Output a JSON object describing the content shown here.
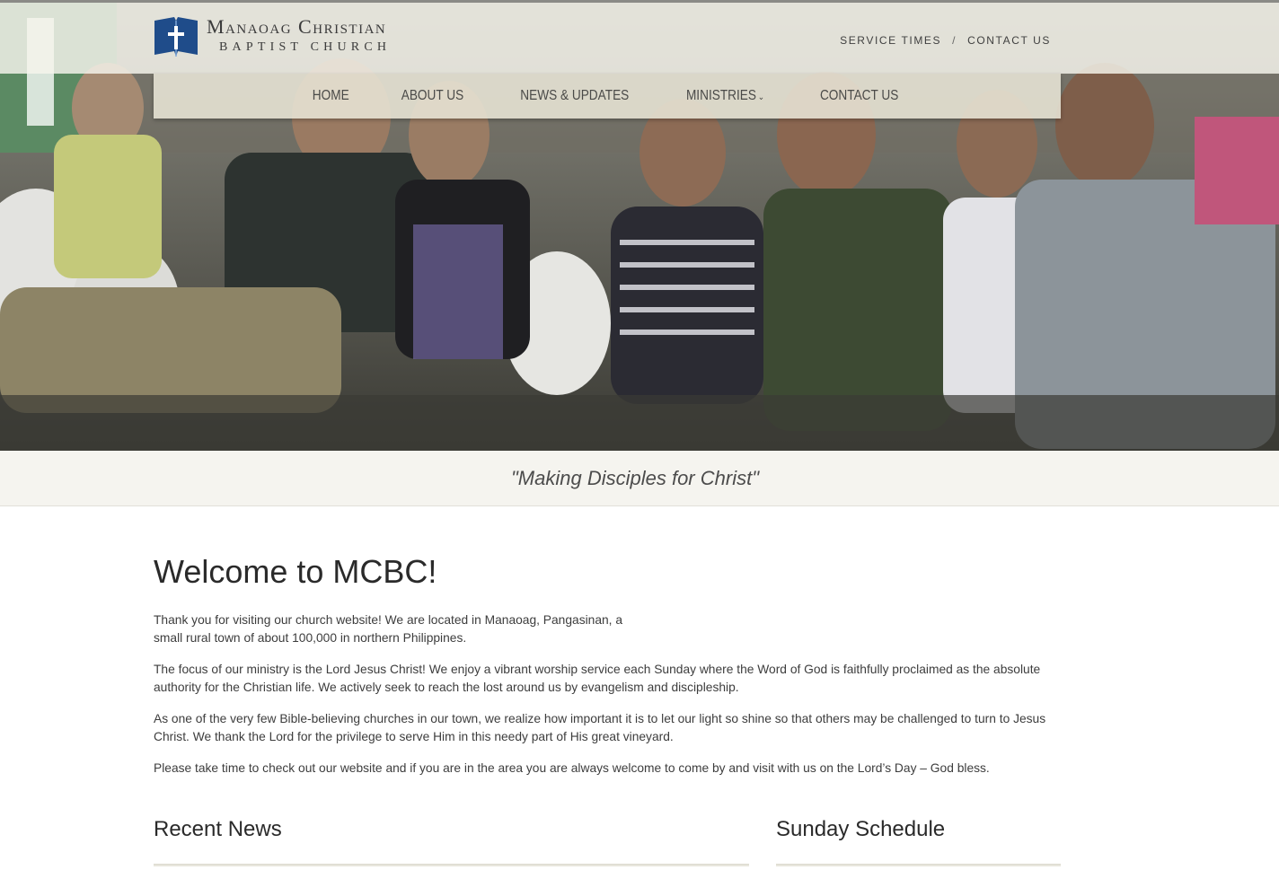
{
  "brand": {
    "name_line1": "Manaoag Christian",
    "name_line2": "BAPTIST CHURCH"
  },
  "utility_nav": {
    "service_times": "SERVICE TIMES",
    "separator": "/",
    "contact": "CONTACT US"
  },
  "main_nav": {
    "items": [
      {
        "label": "HOME"
      },
      {
        "label": "ABOUT US"
      },
      {
        "label": "NEWS & UPDATES"
      },
      {
        "label": "MINISTRIES",
        "dropdown": true
      },
      {
        "label": "CONTACT US"
      }
    ]
  },
  "hero": {
    "image_subject": "congregation seated in white plastic chairs"
  },
  "tagline": "\"Making Disciples for Christ\"",
  "welcome": {
    "title": "Welcome to MCBC!",
    "paragraphs": [
      "Thank you for visiting our church website! We are located in Manaoag, Pangasinan, a small rural town of about 100,000  in northern Philippines.",
      "The focus of our ministry is the Lord Jesus Christ! We enjoy a vibrant worship service each Sunday where the Word of God is faithfully proclaimed as the absolute authority for the Christian life. We actively seek to reach the lost around us by evangelism and discipleship.",
      "As one of the very few Bible-believing churches in our town, we realize how important it is to let our light so shine so that others may be challenged to turn to Jesus Christ. We thank the Lord for the privilege to serve Him in this needy part of His great vineyard.",
      "Please take time to check out our website and if you are in the area you are always welcome to come by and visit with us on the Lord’s Day – God bless."
    ]
  },
  "sections": {
    "recent_news": "Recent News",
    "sunday_schedule": "Sunday Schedule"
  },
  "colors": {
    "logo_blue": "#1f4c8a",
    "nav_bg": "#e8e5d6",
    "tagline_bg": "#f5f4ef",
    "text": "#333333"
  }
}
